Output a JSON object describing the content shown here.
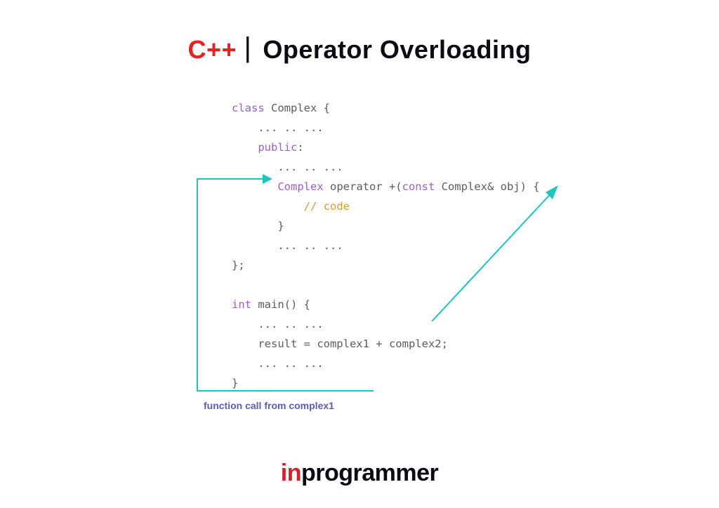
{
  "title": {
    "cpp": "C++",
    "separator": "|",
    "main": "Operator Overloading"
  },
  "code": {
    "line1_kw": "class",
    "line1_rest": " Complex {",
    "line2": "    ... .. ...",
    "line3_kw": "public",
    "line3_colon": ":",
    "line4": "       ... .. ...",
    "line5_type": "Complex",
    "line5_mid": " operator +(",
    "line5_const": "const",
    "line5_rest": " Complex& obj) {",
    "line6_indent": "           ",
    "line6_comment": "// code",
    "line7": "       }",
    "line8": "       ... .. ...",
    "line9": "};",
    "line10": "",
    "line11_kw": "int",
    "line11_rest": " main() {",
    "line12": "    ... .. ...",
    "line13": "    result = complex1 + complex2;",
    "line14": "    ... .. ...",
    "line15": "}"
  },
  "caption": "function call from complex1",
  "footer": {
    "in": "in",
    "programmer": "programmer"
  }
}
